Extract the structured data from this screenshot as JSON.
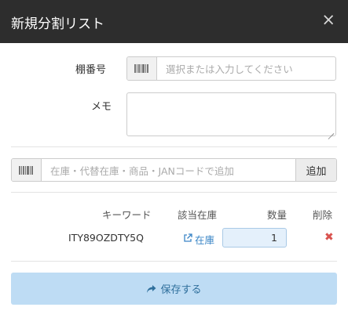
{
  "dialog": {
    "title": "新規分割リスト",
    "close_label": "×"
  },
  "form": {
    "shelf_label": "棚番号",
    "shelf_placeholder": "選択または入力してください",
    "memo_label": "メモ",
    "memo_value": ""
  },
  "search": {
    "placeholder": "在庫・代替在庫・商品・JANコードで追加",
    "add_label": "追加"
  },
  "table": {
    "headers": [
      "キーワード",
      "該当在庫",
      "数量",
      "削除"
    ],
    "rows": [
      {
        "keyword": "ITY89OZDTY5Q",
        "stock_link": "在庫",
        "quantity": "1",
        "delete": "✖"
      }
    ]
  },
  "footer": {
    "save_label": "保存する"
  },
  "colors": {
    "header_bg": "#2d2d2d",
    "save_bg": "#bedcf4",
    "link": "#3a85c6",
    "delete": "#d9534f",
    "qty_bg": "#e4f0fb"
  },
  "icons": {
    "close": "close-icon",
    "barcode": "barcode-icon",
    "external": "external-link-icon",
    "delete": "delete-icon",
    "save": "share-arrow-icon"
  }
}
